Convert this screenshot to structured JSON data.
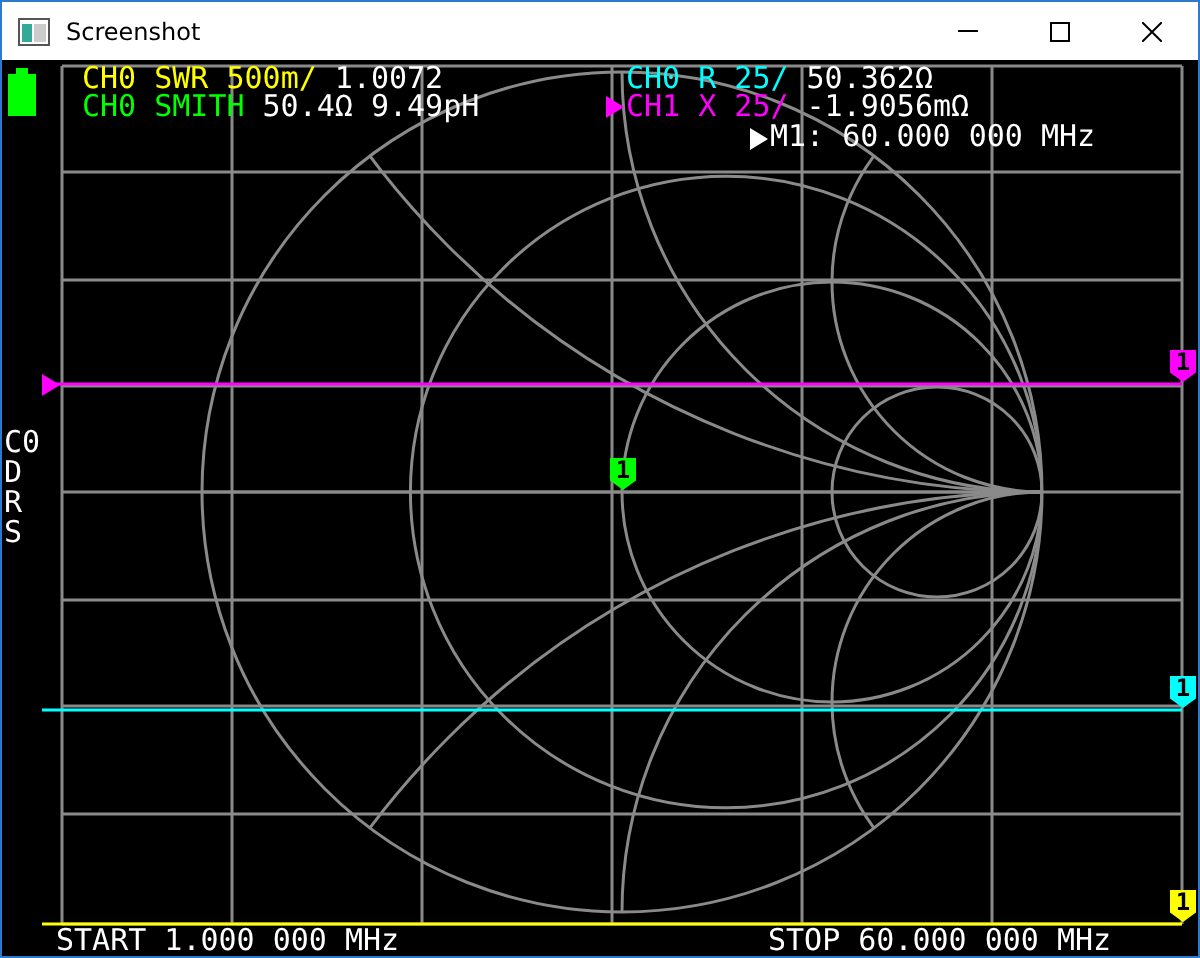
{
  "window": {
    "title": "Screenshot"
  },
  "traces": [
    {
      "kind": "line",
      "label": "CH0 SWR 500m/",
      "reading": "1.0072",
      "color": "#ffff00",
      "selected": false
    },
    {
      "kind": "smith",
      "label": "CH0 SMITH",
      "reading": "50.4Ω 9.49pH",
      "color": "#00ff00",
      "selected": false
    },
    {
      "kind": "line",
      "label": "CH0 R 25/",
      "reading": "50.362Ω",
      "color": "#00ffff",
      "selected": false
    },
    {
      "kind": "line",
      "label": "CH1 X 25/",
      "reading": "-1.9056mΩ",
      "color": "#ff00ff",
      "selected": true
    }
  ],
  "active_marker": {
    "text": "M1: 60.000 000 MHz"
  },
  "markers": [
    {
      "label": "1",
      "color": "#ff00ff"
    },
    {
      "label": "1",
      "color": "#00ff00"
    },
    {
      "label": "1",
      "color": "#00ffff"
    },
    {
      "label": "1",
      "color": "#ffff00"
    }
  ],
  "side_menu": [
    "C0",
    "D",
    "R",
    "S"
  ],
  "sweep": {
    "start": "START 1.000 000 MHz",
    "stop": "STOP 60.000 000 MHz"
  }
}
